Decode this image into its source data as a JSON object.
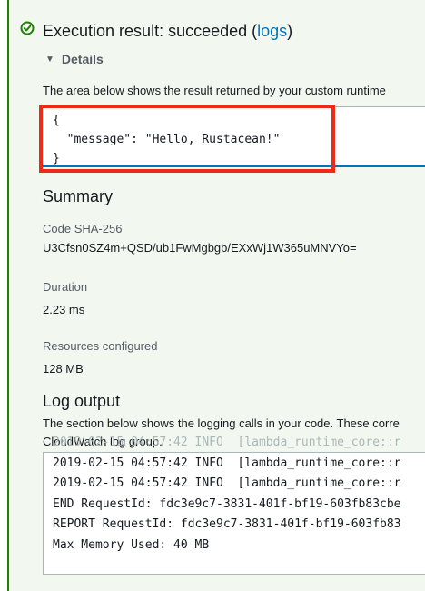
{
  "result": {
    "title_prefix": "Execution result: succeeded (",
    "logs_link": "logs",
    "title_suffix": ")",
    "details_label": "Details",
    "description": "The area below shows the result returned by your custom runtime",
    "output_lines": [
      "{",
      "  \"message\": \"Hello, Rustacean!\"",
      "}"
    ]
  },
  "summary": {
    "heading": "Summary",
    "code_sha_label": "Code SHA-256",
    "code_sha_value": "U3Cfsn0SZ4m+QSD/ub1FwMgbgb/EXxWj1W365uMNVYo=",
    "duration_label": "Duration",
    "duration_value": "2.23 ms",
    "resources_label": "Resources configured",
    "resources_value": "128 MB"
  },
  "log_output": {
    "heading": "Log output",
    "description_line1": "The section below shows the logging calls in your code. These corre",
    "description_line2": "CloudWatch log group.",
    "lines": [
      "2019-02-15 04:57:42 INFO  [lambda_runtime_core::r",
      "2019-02-15 04:57:42 INFO  [lambda_runtime_core::r",
      "2019-02-15 04:57:42 INFO  [lambda_runtime_core::r",
      "END RequestId: fdc3e9c7-3831-401f-bf19-603fb83cbe",
      "REPORT RequestId: fdc3e9c7-3831-401f-bf19-603fb83",
      "Max Memory Used: 40 MB"
    ]
  },
  "icons": {
    "status": "check-circle-icon",
    "expand": "caret-down-icon"
  },
  "colors": {
    "success": "#1d8102",
    "link": "#0073bb",
    "highlight": "#ee2a16"
  }
}
